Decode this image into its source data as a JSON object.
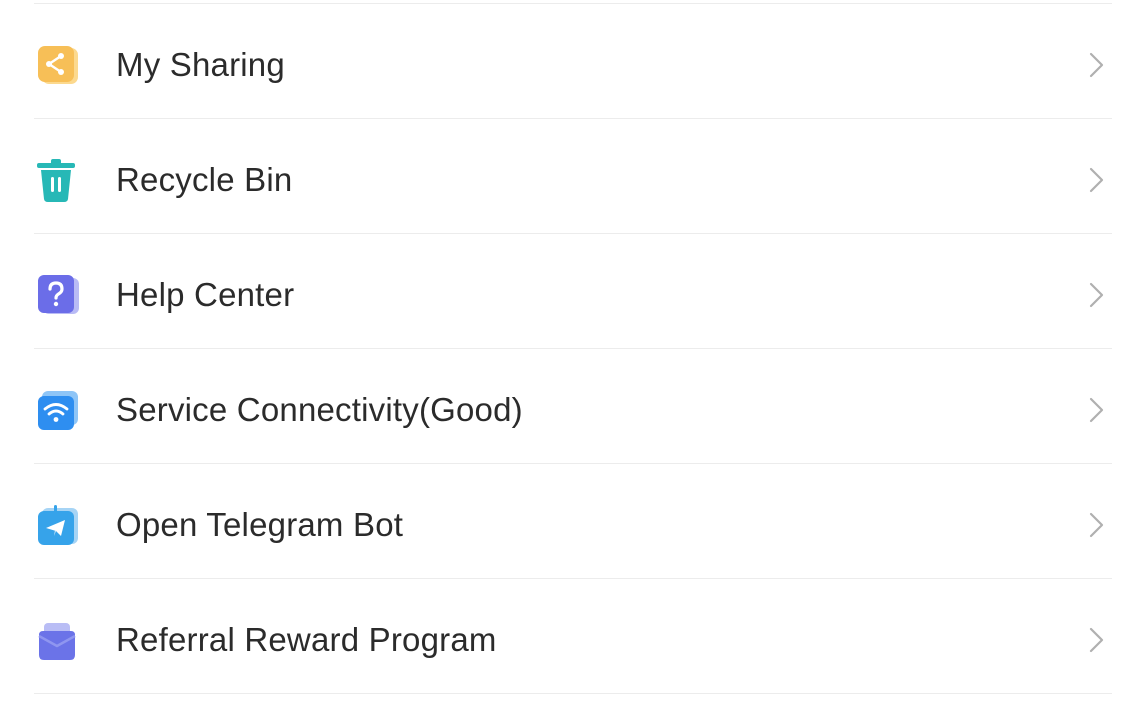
{
  "menu": {
    "items": [
      {
        "label": "My Sharing",
        "icon": "share-icon",
        "color": "#f7bf57"
      },
      {
        "label": "Recycle Bin",
        "icon": "trash-icon",
        "color": "#27b8b6"
      },
      {
        "label": "Help Center",
        "icon": "help-icon",
        "color": "#6b6de8"
      },
      {
        "label": "Service Connectivity(Good)",
        "icon": "wifi-icon",
        "color": "#2e8ef0"
      },
      {
        "label": "Open Telegram Bot",
        "icon": "telegram-icon",
        "color": "#36a3ea"
      },
      {
        "label": "Referral Reward Program",
        "icon": "mail-icon",
        "color": "#6b73e8"
      }
    ],
    "chevron_icon": "chevron-right-icon"
  }
}
